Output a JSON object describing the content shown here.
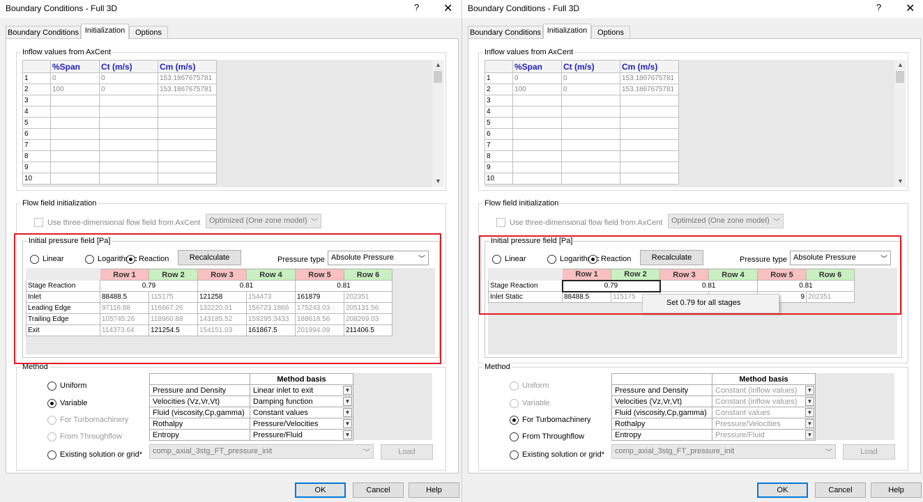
{
  "dialog_title": "Boundary Conditions - Full 3D",
  "help_glyph": "?",
  "close_glyph": "✕",
  "tabs": [
    "Boundary Conditions",
    "Initialization",
    "Options"
  ],
  "active_tab": "Initialization",
  "inflow": {
    "label": "Inflow values from AxCent",
    "columns": [
      "%Span",
      "Ct (m/s)",
      "Cm (m/s)"
    ],
    "row_numbers": [
      "1",
      "2",
      "3",
      "4",
      "5",
      "6",
      "7",
      "8",
      "9",
      "10"
    ],
    "rows": [
      [
        "0",
        "0",
        "153.1867675781"
      ],
      [
        "100",
        "0",
        "153.1867675781"
      ]
    ]
  },
  "flowfield": {
    "label": "Flow field initialization",
    "use_3d_label": "Use three-dimensional flow field from AxCent",
    "model_value": "Optimized (One zone model)"
  },
  "pressure": {
    "label": "Initial pressure field [Pa]",
    "options": [
      "Linear",
      "Logarithmic",
      "Reaction"
    ],
    "recalculate": "Recalculate",
    "pressure_type_label": "Pressure type",
    "pressure_type_value": "Absolute Pressure",
    "row_headers": [
      "Row 1",
      "Row 2",
      "Row 3",
      "Row 4",
      "Row 5",
      "Row 6"
    ],
    "stage_reaction_label": "Stage Reaction",
    "stage_reactions": [
      "0.79",
      "0.81",
      "0.81"
    ],
    "left_rows": [
      {
        "label": "Inlet",
        "values": [
          "88488.5",
          "115175",
          "121258",
          "154473",
          "161879",
          "202351"
        ]
      },
      {
        "label": "Leading Edge",
        "values": [
          "97116.88",
          "116667.26",
          "132220.01",
          "156723.1866",
          "175243.03",
          "205131.56"
        ]
      },
      {
        "label": "Trailing Edge",
        "values": [
          "105745.26",
          "118960.88",
          "143185.52",
          "159295.3433",
          "188618.56",
          "208269.03"
        ]
      },
      {
        "label": "Exit",
        "values": [
          "114373.64",
          "121254.5",
          "154151.03",
          "161867.5",
          "201994.09",
          "211406.5"
        ]
      }
    ],
    "right_rows": [
      {
        "label": "Inlet Static",
        "values": [
          "88488.5",
          "115175",
          "",
          "",
          "9",
          "202351"
        ]
      }
    ],
    "context_menu_item": "Set 0.79 for all stages"
  },
  "method": {
    "label": "Method",
    "options": [
      "Uniform",
      "Variable",
      "For Turbomachinery",
      "From Throughflow",
      "Existing solution or grid*"
    ],
    "table_header": "Method basis",
    "quantities": [
      "Pressure and Density",
      "Velocities (Vz,Vr,Vt)",
      "Fluid (viscosity,Cp,gamma)",
      "Rothalpy",
      "Entropy"
    ],
    "left_basis": [
      "Linear inlet to exit",
      "Damping function",
      "Constant values",
      "Pressure/Velocities",
      "Pressure/Fluid"
    ],
    "right_basis": [
      "Constant (inflow values)",
      "Constant (inflow values)",
      "Constant values",
      "Pressure/Velocities",
      "Pressure/Fluid"
    ],
    "existing_value": "comp_axial_3stg_FT_pressure_init",
    "load_label": "Load"
  },
  "buttons": {
    "ok": "OK",
    "cancel": "Cancel",
    "help": "Help"
  },
  "colors": {
    "highlight_box": "#e01b24",
    "row_odd_header": "#f8c0c0",
    "row_even_header": "#c8f0c0",
    "column_header_text": "#2020c0",
    "default_button_border": "#0078d7"
  }
}
